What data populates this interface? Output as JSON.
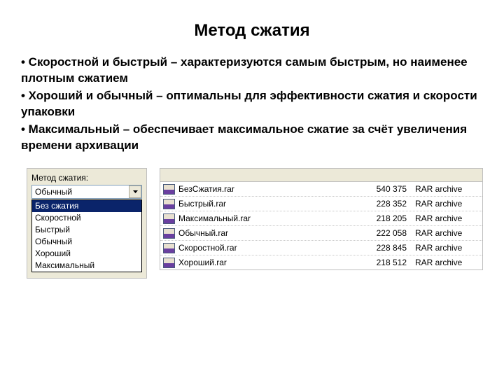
{
  "title": "Метод сжатия",
  "bullets": [
    "• Скоростной и быстрый – характеризуются самым быстрым, но наименее плотным сжатием",
    "• Хороший и обычный – оптимальны для эффективности сжатия и скорости упаковки",
    "• Максимальный – обеспечивает максимальное сжатие за счёт увеличения времени архивации"
  ],
  "dropdown": {
    "label": "Метод сжатия:",
    "value": "Обычный",
    "options": [
      "Без сжатия",
      "Скоростной",
      "Быстрый",
      "Обычный",
      "Хороший",
      "Максимальный"
    ],
    "selected_index": 0
  },
  "files": [
    {
      "name": "БезСжатия.rar",
      "size": "540 375",
      "type": "RAR archive"
    },
    {
      "name": "Быстрый.rar",
      "size": "228 352",
      "type": "RAR archive"
    },
    {
      "name": "Максимальный.rar",
      "size": "218 205",
      "type": "RAR archive"
    },
    {
      "name": "Обычный.rar",
      "size": "222 058",
      "type": "RAR archive"
    },
    {
      "name": "Скоростной.rar",
      "size": "228 845",
      "type": "RAR archive"
    },
    {
      "name": "Хороший.rar",
      "size": "218 512",
      "type": "RAR archive"
    }
  ]
}
